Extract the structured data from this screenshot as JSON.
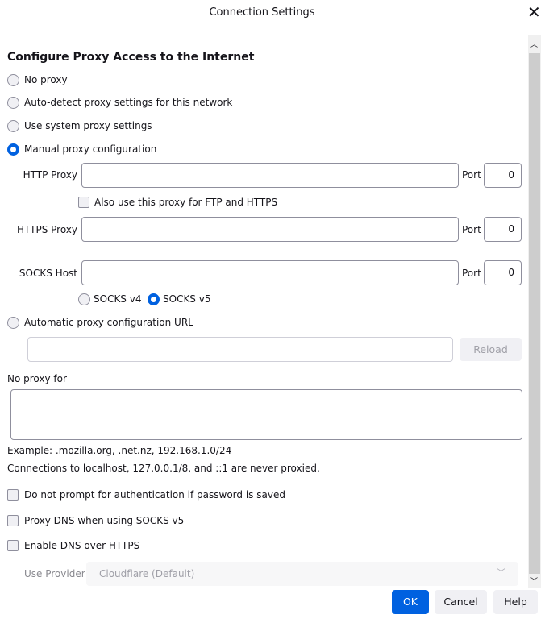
{
  "window": {
    "title": "Connection Settings",
    "close": "✕"
  },
  "heading": "Configure Proxy Access to the Internet",
  "proxy_options": [
    {
      "label": "No proxy",
      "selected": false
    },
    {
      "label": "Auto-detect proxy settings for this network",
      "selected": false
    },
    {
      "label": "Use system proxy settings",
      "selected": false
    },
    {
      "label": "Manual proxy configuration",
      "selected": true
    }
  ],
  "manual": {
    "http_label": "HTTP Proxy",
    "http_value": "",
    "http_port": "0",
    "port_label": "Port",
    "also_use_label": "Also use this proxy for FTP and HTTPS",
    "https_label": "HTTPS Proxy",
    "https_value": "",
    "https_port": "0",
    "socks_label": "SOCKS Host",
    "socks_value": "",
    "socks_port": "0",
    "socks_v4": "SOCKS v4",
    "socks_v5": "SOCKS v5",
    "socks_version": "v5"
  },
  "auto_url": {
    "label": "Automatic proxy configuration URL",
    "value": "",
    "reload": "Reload"
  },
  "no_proxy": {
    "label": "No proxy for",
    "value": "",
    "example": "Example: .mozilla.org, .net.nz, 192.168.1.0/24",
    "note": "Connections to localhost, 127.0.0.1/8, and ::1 are never proxied."
  },
  "checkboxes": [
    {
      "label": "Do not prompt for authentication if password is saved",
      "checked": false
    },
    {
      "label": "Proxy DNS when using SOCKS v5",
      "checked": false
    },
    {
      "label": "Enable DNS over HTTPS",
      "checked": false
    }
  ],
  "provider": {
    "label": "Use Provider",
    "value": "Cloudflare (Default)"
  },
  "buttons": {
    "ok": "OK",
    "cancel": "Cancel",
    "help": "Help"
  },
  "colors": {
    "accent": "#0061e0"
  }
}
